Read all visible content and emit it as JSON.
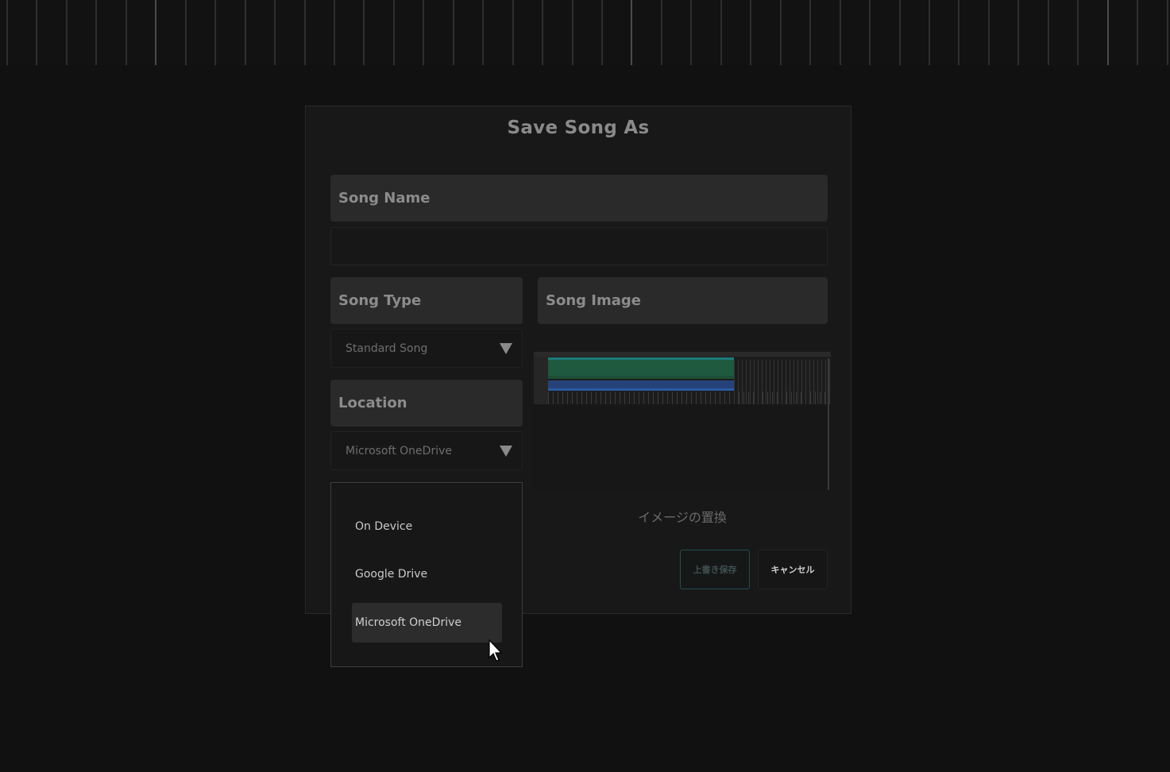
{
  "dialog": {
    "title": "Save Song As"
  },
  "song_name": {
    "header": "Song Name",
    "value": ""
  },
  "song_type": {
    "header": "Song Type",
    "selected": "Standard Song"
  },
  "song_image": {
    "header": "Song Image",
    "replace_label": "イメージの置換"
  },
  "location": {
    "header": "Location",
    "selected": "Microsoft OneDrive",
    "options": [
      "On Device",
      "Google Drive",
      "Microsoft OneDrive"
    ]
  },
  "buttons": {
    "save_label": "上書き保存",
    "cancel_label": "キャンセル"
  },
  "colors": {
    "background": "#111111",
    "dialog": "#181818",
    "header": "#2a2a2a",
    "accent": "#1f4f4c"
  }
}
